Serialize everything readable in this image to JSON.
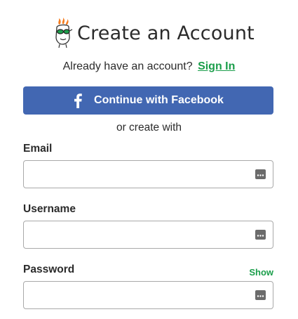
{
  "header": {
    "title": "Create an Account",
    "logo_icon": "godaddy-guy-logo-icon"
  },
  "signin": {
    "prompt": "Already have an account?",
    "link_label": "Sign In"
  },
  "facebook": {
    "label": "Continue with Facebook",
    "icon": "facebook-f-icon",
    "color": "#4267b2"
  },
  "divider_text": "or create with",
  "fields": {
    "email": {
      "label": "Email",
      "value": "",
      "placeholder": ""
    },
    "username": {
      "label": "Username",
      "value": "",
      "placeholder": ""
    },
    "password": {
      "label": "Password",
      "value": "",
      "placeholder": "",
      "show_label": "Show"
    }
  },
  "colors": {
    "accent_green": "#1b9e4b",
    "text": "#2b2b2b",
    "input_border": "#a9a9a9"
  }
}
